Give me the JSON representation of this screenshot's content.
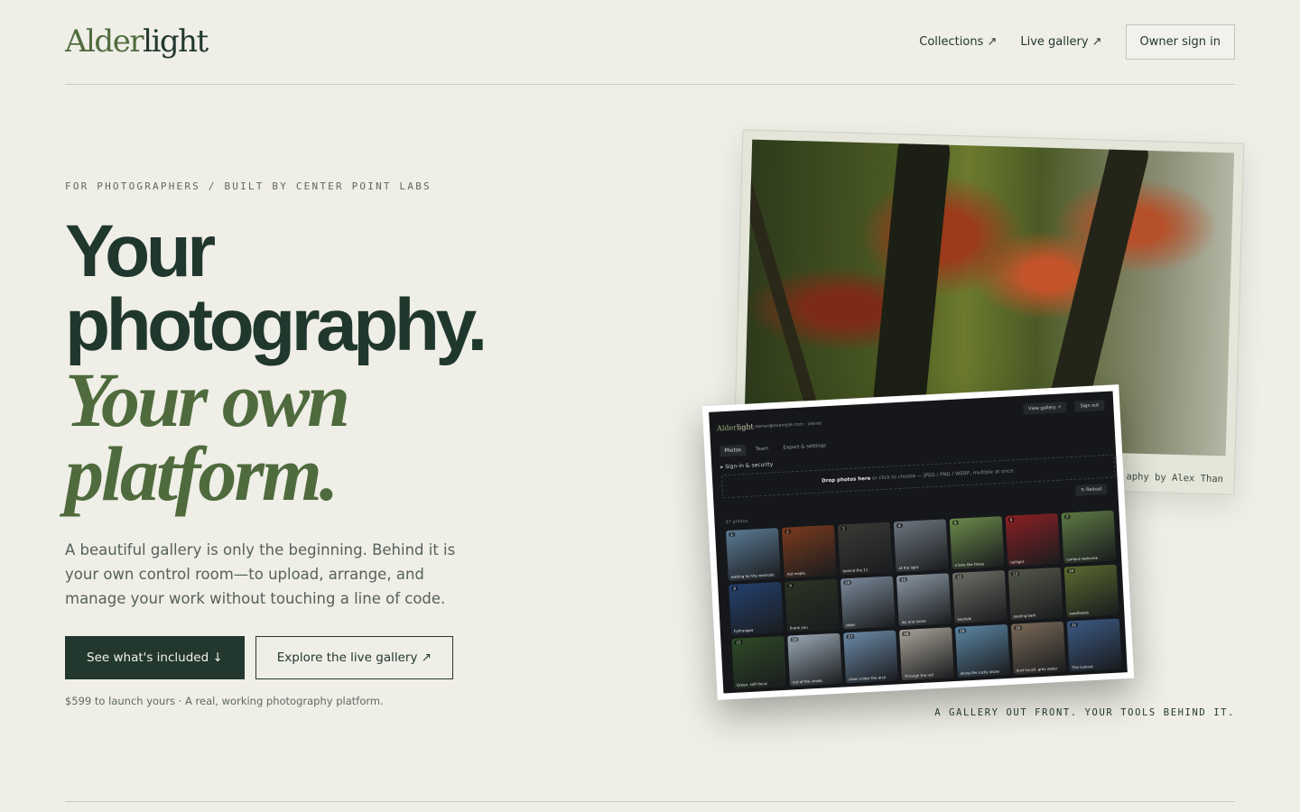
{
  "header": {
    "logo_part1": "Alder",
    "logo_part2": "light",
    "nav": {
      "collections": "Collections ↗",
      "live_gallery": "Live gallery ↗",
      "owner_sign_in": "Owner sign in"
    }
  },
  "hero": {
    "eyebrow": "FOR PHOTOGRAPHERS / BUILT BY CENTER POINT LABS",
    "headline_line1": "Your",
    "headline_line2": "photography.",
    "headline_line3": "Your own",
    "headline_line4": "platform.",
    "lede": "A beautiful gallery is only the beginning. Behind it is your own control room—to upload, arrange, and manage your work without touching a line of code.",
    "primary_cta": "See what's included ↓",
    "secondary_cta": "Explore the live gallery ↗",
    "price_note": "$599 to launch yours · A real, working photography platform."
  },
  "showcase": {
    "photo_caption": "aphy by Alex Than",
    "tagline": "A GALLERY OUT FRONT. YOUR TOOLS BEHIND IT.",
    "admin": {
      "logo_part1": "Alder",
      "logo_part2": "light",
      "email": "owner@example.com · owner",
      "view_gallery": "View gallery ↗",
      "sign_out": "Sign out",
      "tabs": [
        "Photos",
        "Team",
        "Export & settings"
      ],
      "security": "▸ Sign-in & security",
      "drop_bold": "Drop photos here",
      "drop_rest": " or click to choose — JPEG / PNG / WEBP, multiple at once.",
      "reload": "↻ Reload",
      "count": "37 photos",
      "thumbs": [
        {
          "num": "1",
          "cap": "waiting for the westside",
          "color": "#5b7a94"
        },
        {
          "num": "2",
          "cap": "red maple",
          "color": "#7a3a1e"
        },
        {
          "num": "3",
          "cap": "behind the 11",
          "color": "#3a3a36"
        },
        {
          "num": "4",
          "cap": "at the light",
          "color": "#6d7680"
        },
        {
          "num": "5",
          "cap": "a lane like these",
          "color": "#6a8a4a"
        },
        {
          "num": "6",
          "cap": "taillight",
          "color": "#8a2024"
        },
        {
          "num": "7",
          "cap": "campus welcome",
          "color": "#5d7a44"
        },
        {
          "num": "8",
          "cap": "hydrangea",
          "color": "#24406e"
        },
        {
          "num": "9",
          "cap": "thank you",
          "color": "#2c3324"
        },
        {
          "num": "10",
          "cap": "steps",
          "color": "#7b8a9a"
        },
        {
          "num": "11",
          "cap": "lay and stone",
          "color": "#8a96a2"
        },
        {
          "num": "12",
          "cap": "keyhole",
          "color": "#6e6e66"
        },
        {
          "num": "13",
          "cap": "peeling bark",
          "color": "#54584a"
        },
        {
          "num": "14",
          "cap": "seedheads",
          "color": "#5a6a30"
        },
        {
          "num": "15",
          "cap": "Green, soft focus",
          "color": "#2e4a26"
        },
        {
          "num": "16",
          "cap": "out of the shade",
          "color": "#9aa8b4"
        },
        {
          "num": "17",
          "cap": "clean under the arch",
          "color": "#6c8aa8"
        },
        {
          "num": "18",
          "cap": "Through the rail",
          "color": "#a8a298"
        },
        {
          "num": "19",
          "cap": "along the rocky shore",
          "color": "#5c86a4"
        },
        {
          "num": "20",
          "cap": "dust kuuzil, grey water",
          "color": "#7a6a58"
        },
        {
          "num": "21",
          "cap": "The lookout",
          "color": "#3c5a84"
        }
      ]
    }
  }
}
